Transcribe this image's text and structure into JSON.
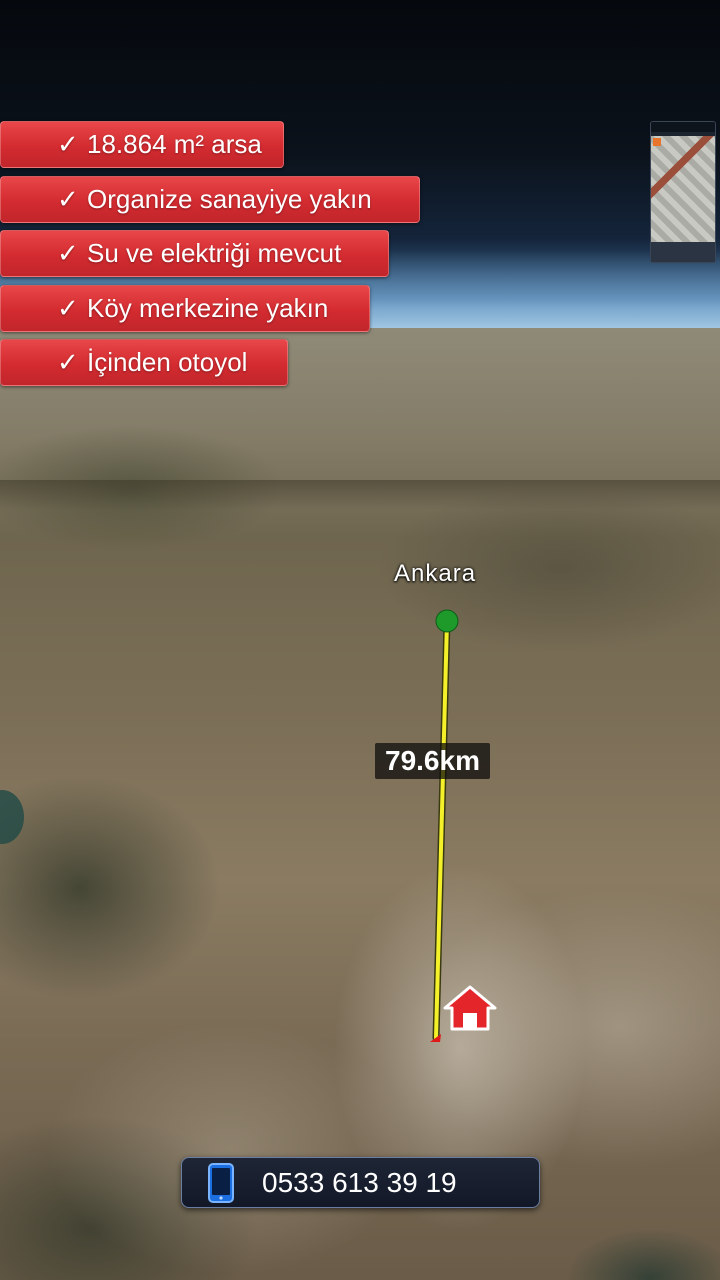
{
  "features": [
    {
      "check": "✓",
      "text": "18.864 m² arsa"
    },
    {
      "check": "✓",
      "text": "Organize sanayiye yakın"
    },
    {
      "check": "✓",
      "text": "Su ve elektriği mevcut"
    },
    {
      "check": "✓",
      "text": "Köy merkezine yakın"
    },
    {
      "check": "✓",
      "text": "İçinden otoyol"
    }
  ],
  "map": {
    "city_label": "Ankara",
    "distance_label": "79.6km",
    "route_color": "#f4f02a",
    "origin_marker_color": "#1e9a2b",
    "destination_icon": "home-icon"
  },
  "contact": {
    "icon": "smartphone-icon",
    "phone": "0533 613 39 19"
  },
  "colors": {
    "badge": "#d32b30",
    "contact_bar": "#121827"
  }
}
